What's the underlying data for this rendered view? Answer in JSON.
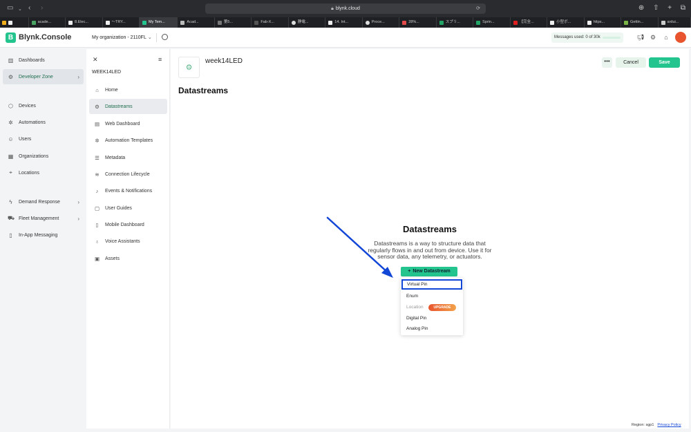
{
  "browser": {
    "url": "blynk.cloud",
    "tabs": [
      {
        "label": ""
      },
      {
        "label": "acade..."
      },
      {
        "label": "8.Elec..."
      },
      {
        "label": "〜TRY..."
      },
      {
        "label": "My Tem...",
        "active": true
      },
      {
        "label": "Acad..."
      },
      {
        "label": "第5..."
      },
      {
        "label": "Fab-X..."
      },
      {
        "label": "静電..."
      },
      {
        "label": "14. Int..."
      },
      {
        "label": "Proce..."
      },
      {
        "label": "28%..."
      },
      {
        "label": "スプリ..."
      },
      {
        "label": "Sprin..."
      },
      {
        "label": "【完全..."
      },
      {
        "label": "小型ボ..."
      },
      {
        "label": "https..."
      },
      {
        "label": "Gettin..."
      },
      {
        "label": "ardui..."
      }
    ]
  },
  "header": {
    "logo_letter": "B",
    "logo_text": "Blynk.Console",
    "org_name": "My organization - 2110FL",
    "messages_used": "Messages used: 0 of 30k",
    "avatar_letter": "",
    "brand_color": "#23c48e"
  },
  "leftnav": {
    "items": [
      {
        "label": "Dashboards",
        "icon": "chart-icon"
      },
      {
        "label": "Developer Zone",
        "icon": "developer-icon"
      },
      {
        "label": "Devices",
        "icon": "cube-icon"
      },
      {
        "label": "Automations",
        "icon": "automation-icon"
      },
      {
        "label": "Users",
        "icon": "user-icon"
      },
      {
        "label": "Organizations",
        "icon": "building-icon"
      },
      {
        "label": "Locations",
        "icon": "location-icon"
      },
      {
        "label": "Demand Response",
        "icon": "lightning-icon"
      },
      {
        "label": "Fleet Management",
        "icon": "fleet-icon"
      },
      {
        "label": "In-App Messaging",
        "icon": "message-icon"
      }
    ]
  },
  "subnav": {
    "template_name": "WEEK14LED",
    "items": [
      {
        "label": "Home"
      },
      {
        "label": "Datastreams"
      },
      {
        "label": "Web Dashboard"
      },
      {
        "label": "Automation Templates"
      },
      {
        "label": "Metadata"
      },
      {
        "label": "Connection Lifecycle"
      },
      {
        "label": "Events & Notifications"
      },
      {
        "label": "User Guides"
      },
      {
        "label": "Mobile Dashboard"
      },
      {
        "label": "Voice Assistants"
      },
      {
        "label": "Assets"
      }
    ]
  },
  "main": {
    "template_title": "week14LED",
    "more_label": "•••",
    "cancel_label": "Cancel",
    "save_label": "Save",
    "page_title": "Datastreams",
    "empty_title": "Datastreams",
    "empty_desc": "Datastreams is a way to structure data that regularly flows in and out from device. Use it for sensor data, any telemetry, or actuators.",
    "new_button": "New Datastream",
    "dropdown": [
      {
        "label": "Virtual Pin"
      },
      {
        "label": "Enum"
      },
      {
        "label": "Location",
        "badge": "UPGRADE"
      },
      {
        "label": "Digital Pin"
      },
      {
        "label": "Analog Pin"
      }
    ]
  },
  "footer": {
    "region": "Region: sgp1",
    "privacy": "Privacy Policy"
  },
  "colors": {
    "annotation_blue": "#1246d6",
    "upgrade_orange": "#e8542d"
  }
}
